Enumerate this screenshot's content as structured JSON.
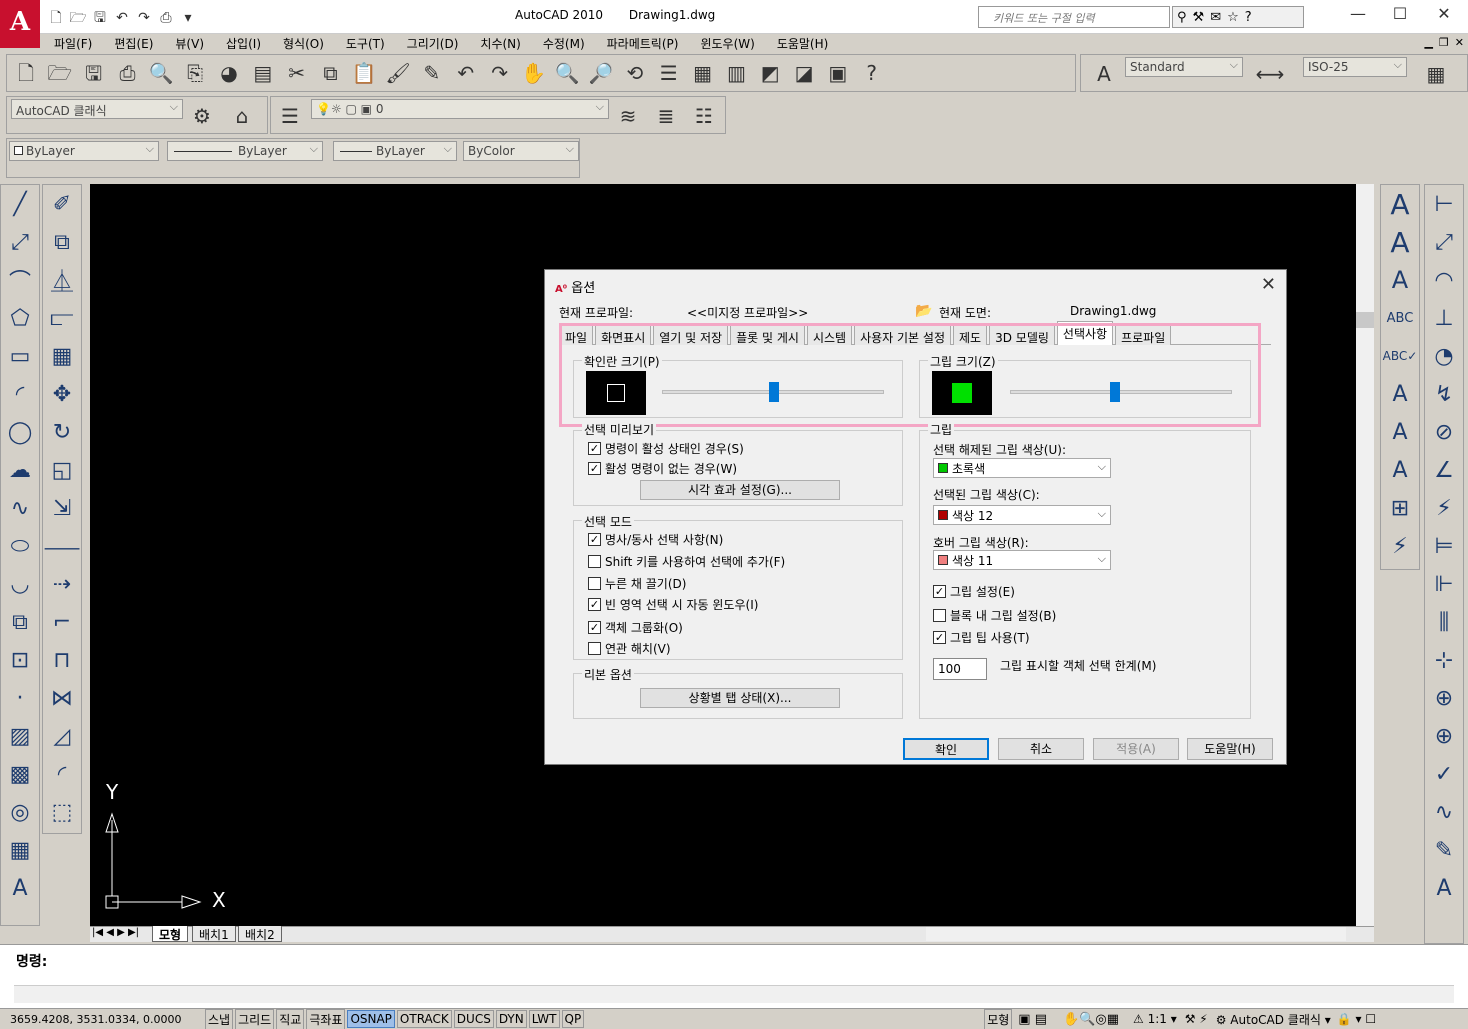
{
  "app": {
    "logo": "A",
    "title": "AutoCAD 2010",
    "document": "Drawing1.dwg",
    "search_placeholder": "키워드 또는 구절 입력"
  },
  "menu": [
    "파일(F)",
    "편집(E)",
    "뷰(V)",
    "삽입(I)",
    "형식(O)",
    "도구(T)",
    "그리기(D)",
    "치수(N)",
    "수정(M)",
    "파라메트릭(P)",
    "윈도우(W)",
    "도움말(H)"
  ],
  "toolbars": {
    "workspace": "AutoCAD 클래식",
    "layer": "0",
    "text_style": "Standard",
    "dim_style": "ISO-25",
    "color": "ByLayer",
    "linetype": "ByLayer",
    "lineweight": "ByLayer",
    "plotstyle": "ByColor"
  },
  "canvas": {
    "axis_y": "Y",
    "axis_x": "X"
  },
  "layout_tabs": [
    "모형",
    "배치1",
    "배치2"
  ],
  "command": {
    "label": "명령:"
  },
  "status": {
    "coords": "3659.4208,  3531.0334, 0.0000",
    "buttons": [
      "스냅",
      "그리드",
      "직교",
      "극좌표",
      "OSNAP",
      "OTRACK",
      "DUCS",
      "DYN",
      "LWT",
      "QP"
    ],
    "active": "OSNAP",
    "model": "모형",
    "scale": "1:1",
    "workspace": "AutoCAD 클래식"
  },
  "dialog": {
    "title": "옵션",
    "current_profile_label": "현재 프로파일:",
    "current_profile_value": "<<미지정 프로파일>>",
    "current_drawing_label": "현재 도면:",
    "current_drawing_value": "Drawing1.dwg",
    "tabs": [
      "파일",
      "화면표시",
      "열기 및 저장",
      "플롯 및 게시",
      "시스템",
      "사용자 기본 설정",
      "제도",
      "3D 모델링",
      "선택사항",
      "프로파일"
    ],
    "active_tab": "선택사항",
    "pickbox_title": "확인란 크기(P)",
    "grip_size_title": "그립 크기(Z)",
    "selection_preview_title": "선택 미리보기",
    "preview_cb1": "명령이 활성 상태인 경우(S)",
    "preview_cb2": "활성 명령이 없는 경우(W)",
    "visual_effects_button": "시각 효과 설정(G)...",
    "selection_mode_title": "선택 모드",
    "mode_cb1": "명사/동사 선택 사항(N)",
    "mode_cb2": "Shift 키를 사용하여 선택에 추가(F)",
    "mode_cb3": "누른 채 끌기(D)",
    "mode_cb4": "빈 영역 선택 시 자동 윈도우(I)",
    "mode_cb5": "객체 그룹화(O)",
    "mode_cb6": "연관 해치(V)",
    "ribbon_title": "리본 옵션",
    "ribbon_button": "상황별 탭 상태(X)...",
    "grips_title": "그립",
    "unselected_label": "선택 해제된 그립 색상(U):",
    "unselected_value": "초록색",
    "unselected_color": "#00c800",
    "selected_label": "선택된 그립 색상(C):",
    "selected_value": "색상 12",
    "selected_color": "#b00000",
    "hover_label": "호버 그립 색상(R):",
    "hover_value": "색상 11",
    "hover_color": "#f08080",
    "grip_cb1": "그립 설정(E)",
    "grip_cb2": "블록 내 그립 설정(B)",
    "grip_cb3": "그립 팁 사용(T)",
    "grip_limit_value": "100",
    "grip_limit_label": "그립 표시할 객체 선택 한계(M)",
    "ok": "확인",
    "cancel": "취소",
    "apply": "적용(A)",
    "help": "도움말(H)"
  }
}
